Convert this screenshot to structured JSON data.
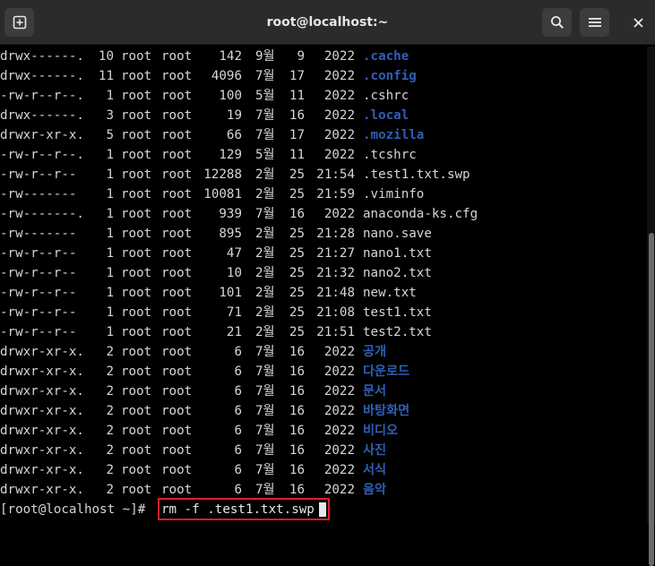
{
  "window": {
    "title": "root@localhost:~"
  },
  "toolbar": {
    "new_tab_icon": "new-tab-icon",
    "search_icon": "search-icon",
    "menu_icon": "hamburger-menu-icon",
    "close_icon": "close-icon"
  },
  "colors": {
    "directory": "#2f5fb6",
    "text": "#d6d6d6",
    "highlight": "#e01e2a"
  },
  "listing": [
    {
      "perms": "drwx------.",
      "links": "10",
      "owner": "root",
      "group": "root",
      "size": "142",
      "month": "9월",
      "day": "9",
      "time": "2022",
      "name": ".cache",
      "dir": true
    },
    {
      "perms": "drwx------.",
      "links": "11",
      "owner": "root",
      "group": "root",
      "size": "4096",
      "month": "7월",
      "day": "17",
      "time": "2022",
      "name": ".config",
      "dir": true
    },
    {
      "perms": "-rw-r--r--.",
      "links": "1",
      "owner": "root",
      "group": "root",
      "size": "100",
      "month": "5월",
      "day": "11",
      "time": "2022",
      "name": ".cshrc",
      "dir": false
    },
    {
      "perms": "drwx------.",
      "links": "3",
      "owner": "root",
      "group": "root",
      "size": "19",
      "month": "7월",
      "day": "16",
      "time": "2022",
      "name": ".local",
      "dir": true
    },
    {
      "perms": "drwxr-xr-x.",
      "links": "5",
      "owner": "root",
      "group": "root",
      "size": "66",
      "month": "7월",
      "day": "17",
      "time": "2022",
      "name": ".mozilla",
      "dir": true
    },
    {
      "perms": "-rw-r--r--.",
      "links": "1",
      "owner": "root",
      "group": "root",
      "size": "129",
      "month": "5월",
      "day": "11",
      "time": "2022",
      "name": ".tcshrc",
      "dir": false
    },
    {
      "perms": "-rw-r--r--",
      "links": "1",
      "owner": "root",
      "group": "root",
      "size": "12288",
      "month": "2월",
      "day": "25",
      "time": "21:54",
      "name": ".test1.txt.swp",
      "dir": false
    },
    {
      "perms": "-rw-------",
      "links": "1",
      "owner": "root",
      "group": "root",
      "size": "10081",
      "month": "2월",
      "day": "25",
      "time": "21:59",
      "name": ".viminfo",
      "dir": false
    },
    {
      "perms": "-rw-------.",
      "links": "1",
      "owner": "root",
      "group": "root",
      "size": "939",
      "month": "7월",
      "day": "16",
      "time": "2022",
      "name": "anaconda-ks.cfg",
      "dir": false
    },
    {
      "perms": "-rw-------",
      "links": "1",
      "owner": "root",
      "group": "root",
      "size": "895",
      "month": "2월",
      "day": "25",
      "time": "21:28",
      "name": "nano.save",
      "dir": false
    },
    {
      "perms": "-rw-r--r--",
      "links": "1",
      "owner": "root",
      "group": "root",
      "size": "47",
      "month": "2월",
      "day": "25",
      "time": "21:27",
      "name": "nano1.txt",
      "dir": false
    },
    {
      "perms": "-rw-r--r--",
      "links": "1",
      "owner": "root",
      "group": "root",
      "size": "10",
      "month": "2월",
      "day": "25",
      "time": "21:32",
      "name": "nano2.txt",
      "dir": false
    },
    {
      "perms": "-rw-r--r--",
      "links": "1",
      "owner": "root",
      "group": "root",
      "size": "101",
      "month": "2월",
      "day": "25",
      "time": "21:48",
      "name": "new.txt",
      "dir": false
    },
    {
      "perms": "-rw-r--r--",
      "links": "1",
      "owner": "root",
      "group": "root",
      "size": "71",
      "month": "2월",
      "day": "25",
      "time": "21:08",
      "name": "test1.txt",
      "dir": false
    },
    {
      "perms": "-rw-r--r--",
      "links": "1",
      "owner": "root",
      "group": "root",
      "size": "21",
      "month": "2월",
      "day": "25",
      "time": "21:51",
      "name": "test2.txt",
      "dir": false
    },
    {
      "perms": "drwxr-xr-x.",
      "links": "2",
      "owner": "root",
      "group": "root",
      "size": "6",
      "month": "7월",
      "day": "16",
      "time": "2022",
      "name": "공개",
      "dir": true
    },
    {
      "perms": "drwxr-xr-x.",
      "links": "2",
      "owner": "root",
      "group": "root",
      "size": "6",
      "month": "7월",
      "day": "16",
      "time": "2022",
      "name": "다운로드",
      "dir": true
    },
    {
      "perms": "drwxr-xr-x.",
      "links": "2",
      "owner": "root",
      "group": "root",
      "size": "6",
      "month": "7월",
      "day": "16",
      "time": "2022",
      "name": "문서",
      "dir": true
    },
    {
      "perms": "drwxr-xr-x.",
      "links": "2",
      "owner": "root",
      "group": "root",
      "size": "6",
      "month": "7월",
      "day": "16",
      "time": "2022",
      "name": "바탕화면",
      "dir": true
    },
    {
      "perms": "drwxr-xr-x.",
      "links": "2",
      "owner": "root",
      "group": "root",
      "size": "6",
      "month": "7월",
      "day": "16",
      "time": "2022",
      "name": "비디오",
      "dir": true
    },
    {
      "perms": "drwxr-xr-x.",
      "links": "2",
      "owner": "root",
      "group": "root",
      "size": "6",
      "month": "7월",
      "day": "16",
      "time": "2022",
      "name": "사진",
      "dir": true
    },
    {
      "perms": "drwxr-xr-x.",
      "links": "2",
      "owner": "root",
      "group": "root",
      "size": "6",
      "month": "7월",
      "day": "16",
      "time": "2022",
      "name": "서식",
      "dir": true
    },
    {
      "perms": "drwxr-xr-x.",
      "links": "2",
      "owner": "root",
      "group": "root",
      "size": "6",
      "month": "7월",
      "day": "16",
      "time": "2022",
      "name": "음악",
      "dir": true
    }
  ],
  "prompt": {
    "text": "[root@localhost ~]#",
    "command": "rm -f .test1.txt.swp"
  }
}
